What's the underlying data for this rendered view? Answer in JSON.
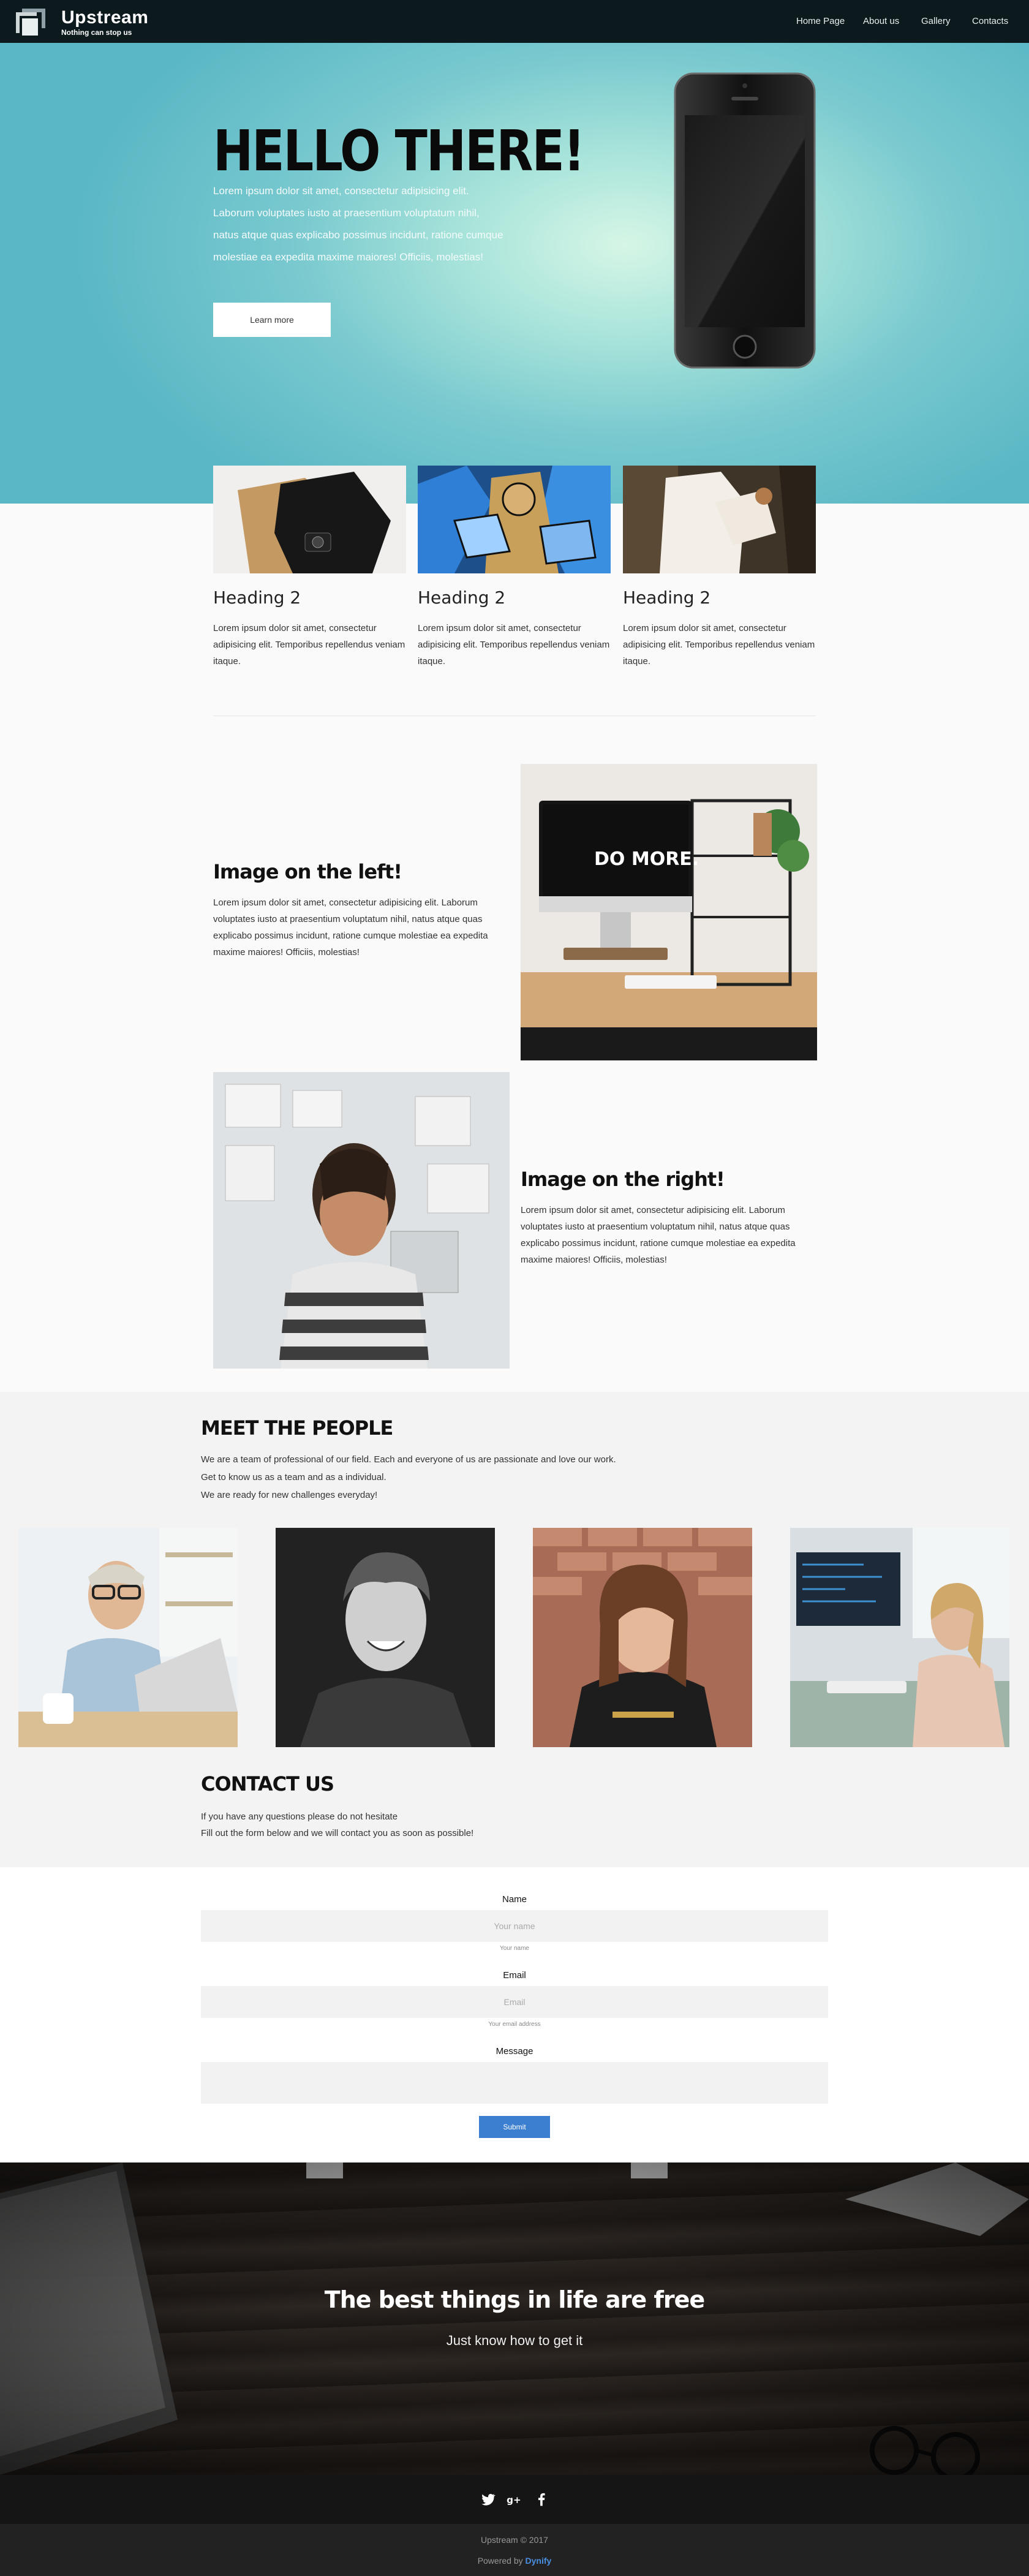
{
  "nav": {
    "brand": "Upstream",
    "tagline": "Nothing can stop us",
    "links": [
      "Home Page",
      "About us",
      "Gallery",
      "Contacts"
    ]
  },
  "hero": {
    "title": "HELLO THERE!",
    "text": "Lorem ipsum dolor sit amet, consectetur adipisicing elit. Laborum voluptates iusto at praesentium voluptatum nihil, natus atque quas explicabo possimus incidunt, ratione cumque molestiae ea expedita maxime maiores! Officiis, molestias!",
    "button": "Learn more"
  },
  "cards": [
    {
      "heading": "Heading 2",
      "text": "Lorem ipsum dolor sit amet, consectetur adipisicing elit. Temporibus repellendus veniam itaque."
    },
    {
      "heading": "Heading 2",
      "text": "Lorem ipsum dolor sit amet, consectetur adipisicing elit. Temporibus repellendus veniam itaque."
    },
    {
      "heading": "Heading 2",
      "text": "Lorem ipsum dolor sit amet, consectetur adipisicing elit. Temporibus repellendus veniam itaque."
    }
  ],
  "features": [
    {
      "title": "Image on the left!",
      "text": "Lorem ipsum dolor sit amet, consectetur adipisicing elit. Laborum voluptates iusto at praesentium voluptatum nihil, natus atque quas explicabo possimus incidunt, ratione cumque molestiae ea expedita maxime maiores! Officiis, molestias!",
      "screen_text": "DO MORE."
    },
    {
      "title": "Image on the right!",
      "text": "Lorem ipsum dolor sit amet, consectetur adipisicing elit. Laborum voluptates iusto at praesentium voluptatum nihil, natus atque quas explicabo possimus incidunt, ratione cumque molestiae ea expedita maxime maiores! Officiis, molestias!"
    }
  ],
  "team": {
    "title": "MEET THE PEOPLE",
    "lines": [
      "We are a team of professional of our field. Each and everyone of us are passionate and love our work.",
      "Get to know us as a team and as a individual.",
      "We are ready for new challenges everyday!"
    ]
  },
  "contact": {
    "title": "CONTACT US",
    "lines": [
      "If you have any questions please do not hesitate",
      "Fill out the form below and we will contact you as soon as possible!"
    ]
  },
  "form": {
    "name_label": "Name",
    "name_placeholder": "Your name",
    "name_help": "Your name",
    "email_label": "Email",
    "email_placeholder": "Email",
    "email_help": "Your email address",
    "message_label": "Message",
    "submit": "Submit"
  },
  "banner": {
    "title": "The best things in life are free",
    "subtitle": "Just know how to get it"
  },
  "footer": {
    "social": [
      "twitter-icon",
      "google-plus-icon",
      "facebook-icon"
    ],
    "copyright": "Upstream © 2017",
    "powered_prefix": "Powered by",
    "powered_brand": "Dynify"
  }
}
